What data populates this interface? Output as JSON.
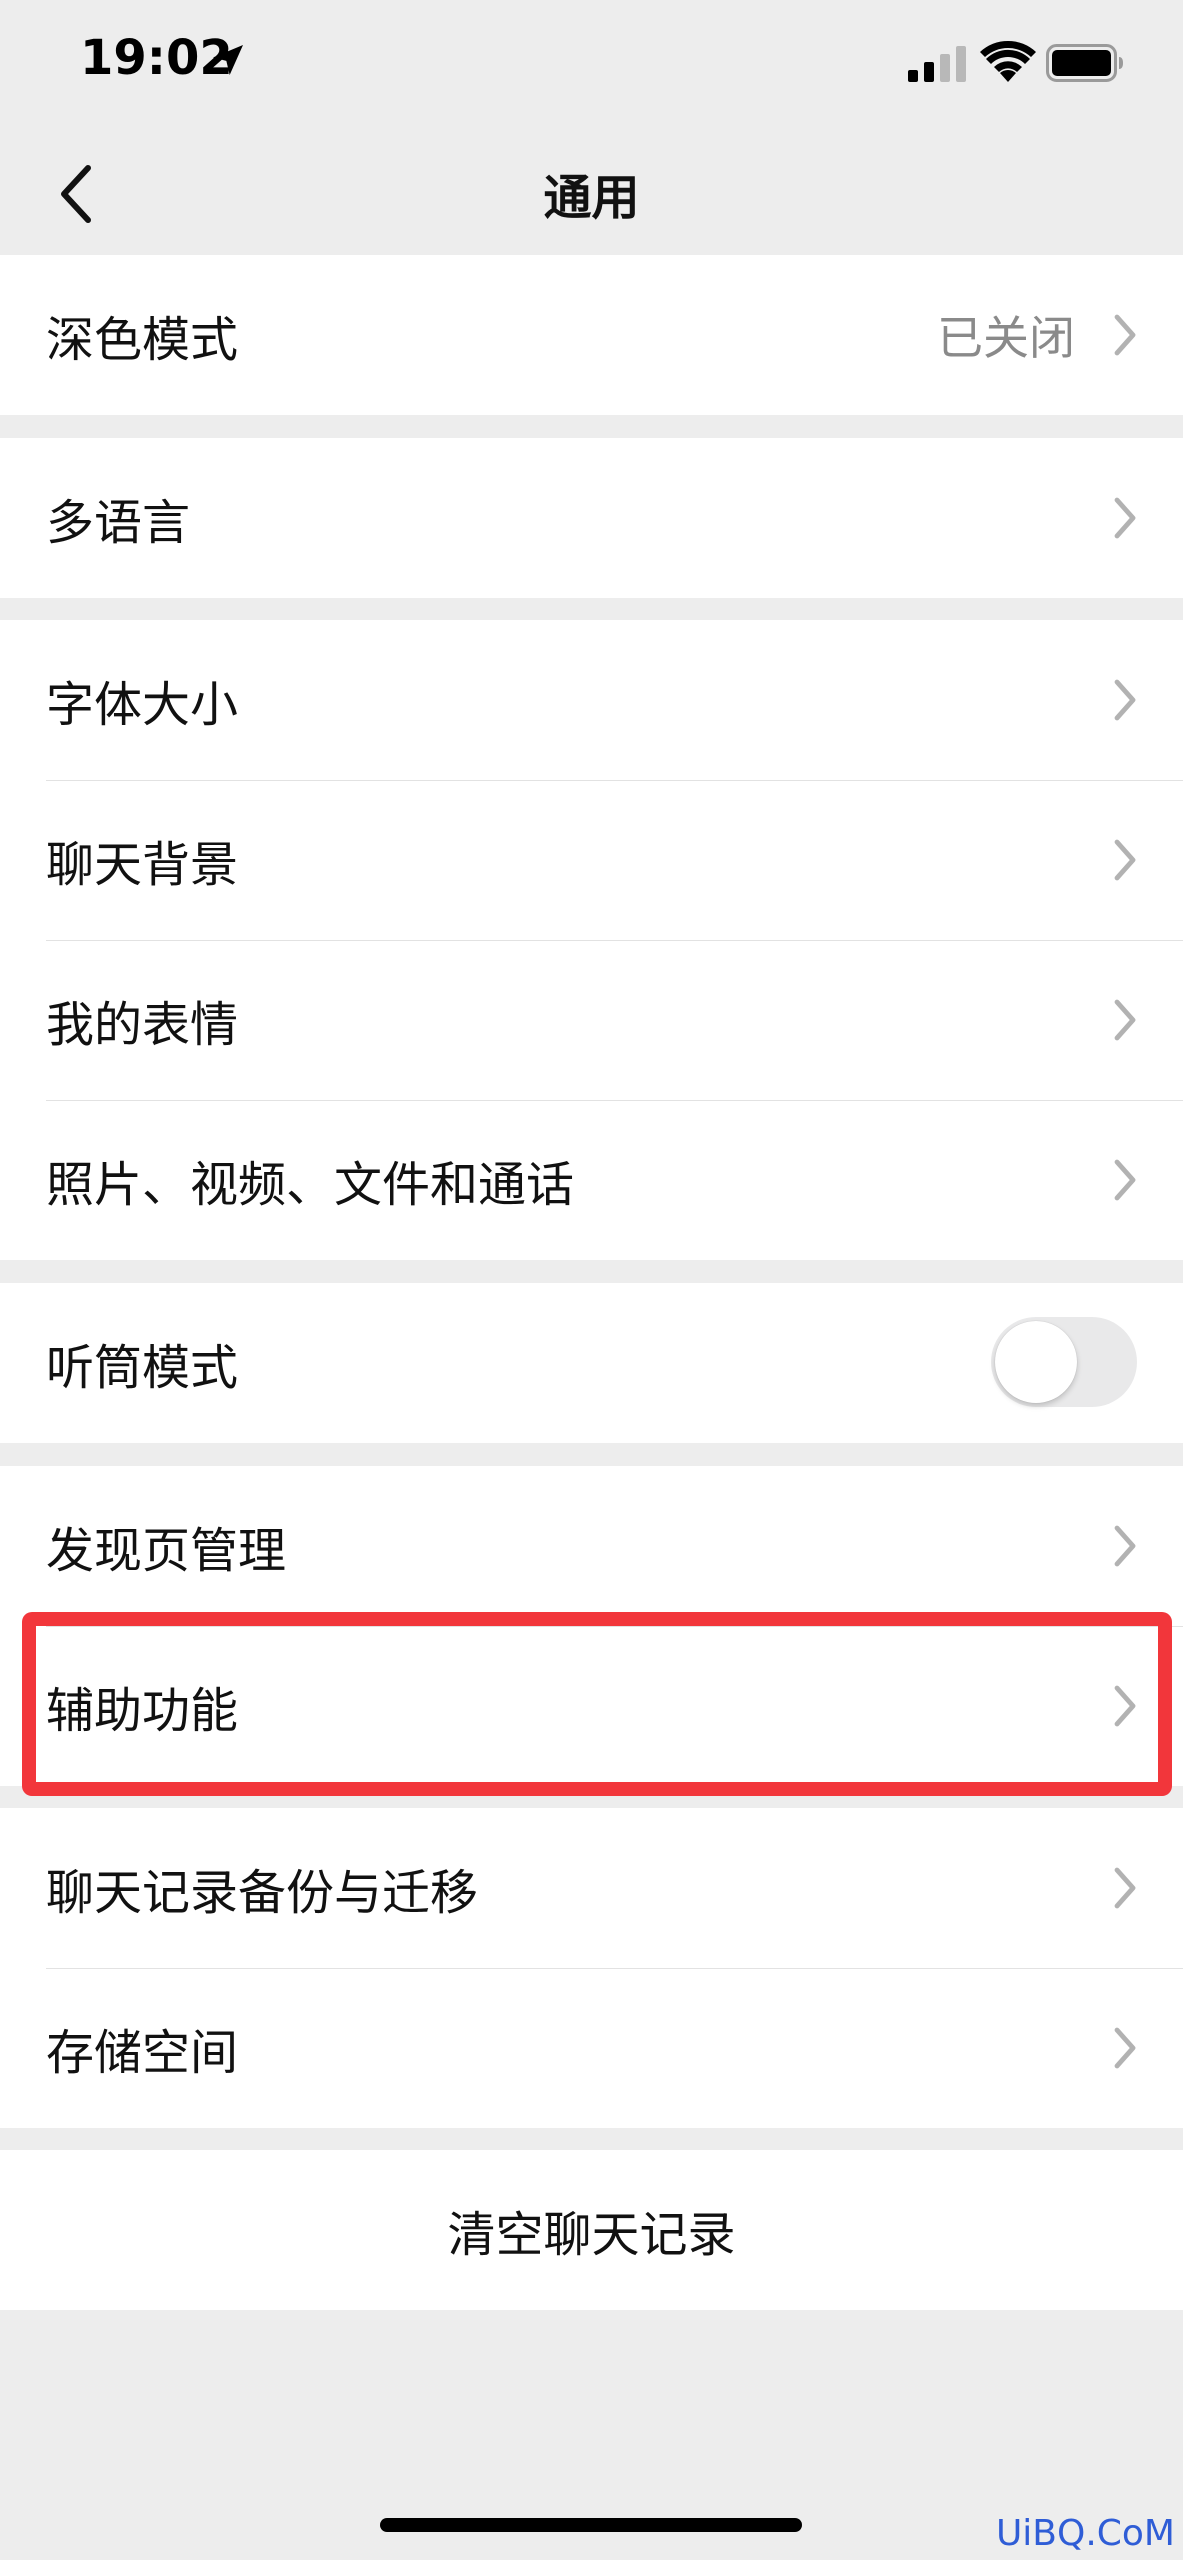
{
  "status_bar": {
    "time": "19:02",
    "icons": [
      "location-arrow-icon",
      "cellular-signal-icon",
      "wifi-icon",
      "battery-icon"
    ]
  },
  "nav": {
    "title": "通用",
    "back_icon": "chevron-left-icon"
  },
  "groups": [
    {
      "items": [
        {
          "label": "深色模式",
          "value": "已关闭",
          "type": "link"
        }
      ]
    },
    {
      "items": [
        {
          "label": "多语言",
          "type": "link"
        }
      ]
    },
    {
      "items": [
        {
          "label": "字体大小",
          "type": "link"
        },
        {
          "label": "聊天背景",
          "type": "link"
        },
        {
          "label": "我的表情",
          "type": "link"
        },
        {
          "label": "照片、视频、文件和通话",
          "type": "link"
        }
      ]
    },
    {
      "items": [
        {
          "label": "听筒模式",
          "type": "toggle",
          "on": false
        }
      ]
    },
    {
      "items": [
        {
          "label": "发现页管理",
          "type": "link"
        },
        {
          "label": "辅助功能",
          "type": "link",
          "highlighted": true
        }
      ]
    },
    {
      "items": [
        {
          "label": "聊天记录备份与迁移",
          "type": "link"
        },
        {
          "label": "存储空间",
          "type": "link"
        }
      ]
    },
    {
      "items": [
        {
          "label": "清空聊天记录",
          "type": "action"
        }
      ]
    }
  ],
  "colors": {
    "background": "#ededed",
    "row_background": "#ffffff",
    "highlight": "#f2363b",
    "secondary_text": "#8a8a8a",
    "chevron": "#b2b2b2",
    "toggle_off": "#e9e9ea"
  },
  "watermark": "UiBQ.CoM"
}
